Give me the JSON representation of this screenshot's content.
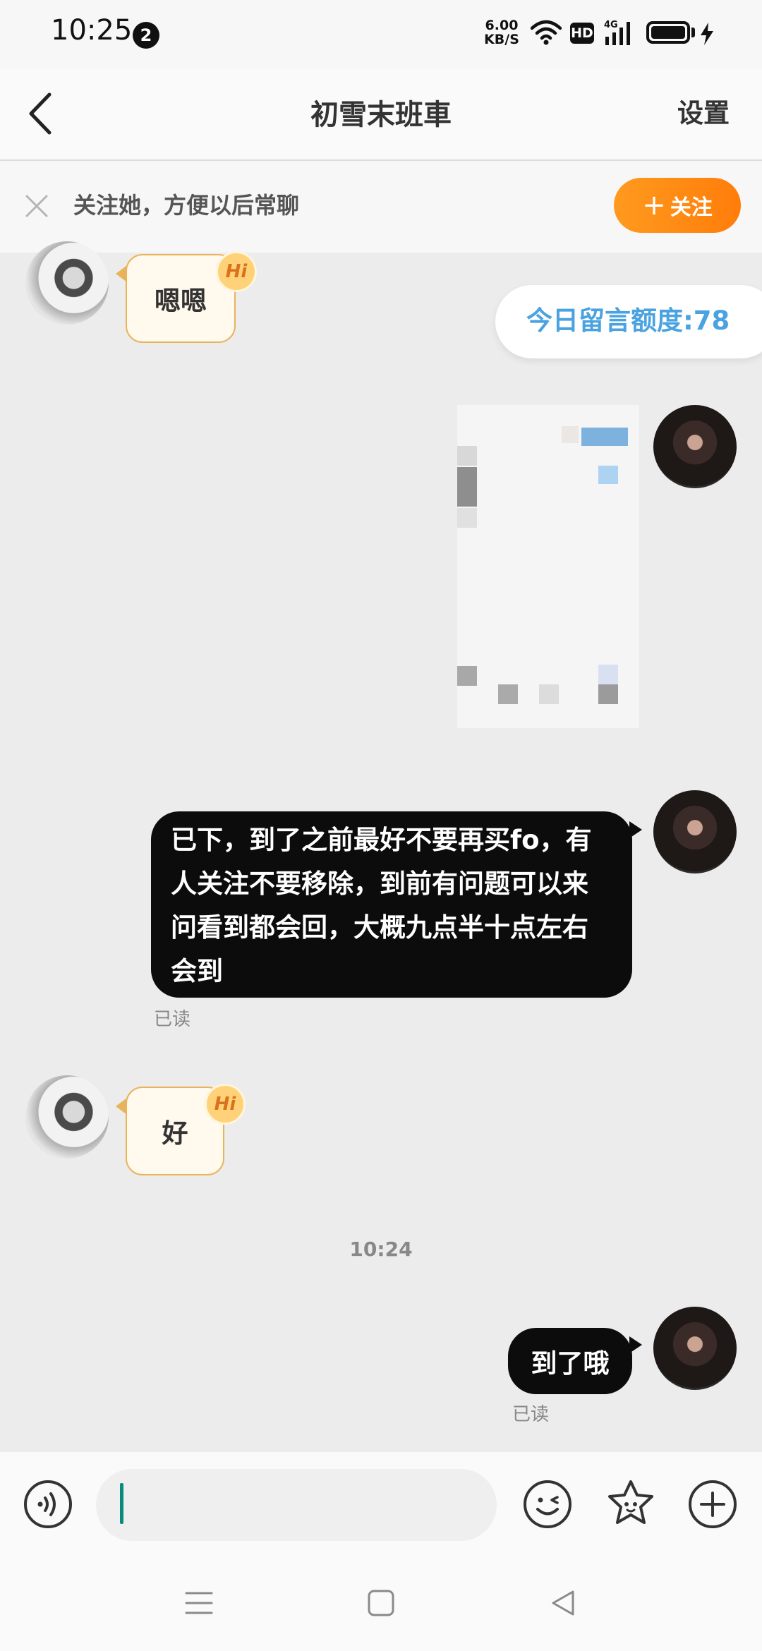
{
  "status_bar": {
    "time": "10:25",
    "notification_count": "2",
    "net_speed_value": "6.00",
    "net_speed_unit": "KB/S",
    "hd_label": "HD",
    "network_type": "4G",
    "battery_level": 1.0,
    "charging": true
  },
  "header": {
    "back_icon": "chevron-left-icon",
    "title": "初雪末班車",
    "settings_label": "设置"
  },
  "follow_banner": {
    "text": "关注她，方便以后常聊",
    "button_label": "关注",
    "button_icon": "plus-icon",
    "close_icon": "close-icon"
  },
  "quota": {
    "text": "今日留言额度:78"
  },
  "messages": [
    {
      "side": "left",
      "text": "嗯嗯",
      "badge": "Hi"
    },
    {
      "side": "right",
      "type": "image",
      "content": "blurred-image"
    },
    {
      "side": "right",
      "lines": [
        "已下，到了之前最好不要再买fo，有",
        "人关注不要移除，到前有问题可以来",
        "问看到都会回，大概九点半十点左右",
        "会到"
      ],
      "status": "已读"
    },
    {
      "side": "left",
      "text": "好",
      "badge": "Hi"
    },
    {
      "side": "right",
      "text": "到了哦",
      "status": "已读"
    }
  ],
  "time_divider": "10:24",
  "input_bar": {
    "voice_icon": "voice-icon",
    "emoji_icon": "emoji-icon",
    "sticker_icon": "star-sticker-icon",
    "add_icon": "plus-circle-icon",
    "value": ""
  },
  "nav": {
    "menu_icon": "menu-icon",
    "home_icon": "home-square-icon",
    "back_icon": "back-triangle-icon"
  },
  "colors": {
    "accent": "#ff8a14",
    "quota_blue": "#4aa3e0",
    "bubble_out": "#0c0c0c",
    "bubble_in_border": "#e8b45b"
  }
}
